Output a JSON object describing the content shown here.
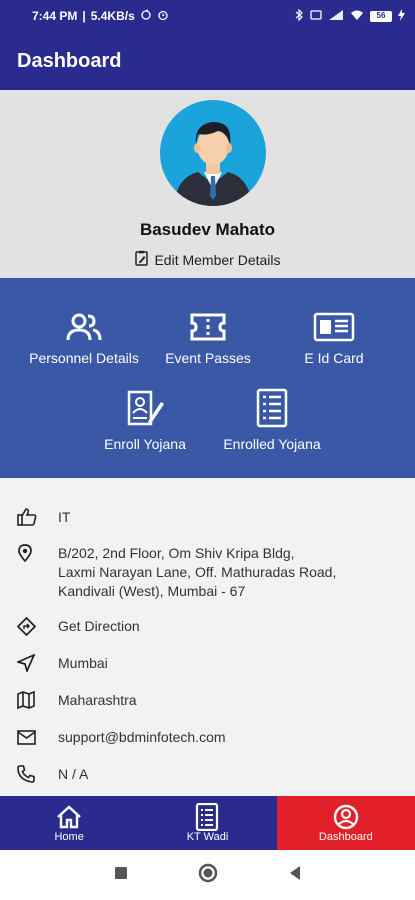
{
  "status_bar": {
    "time": "7:44 PM",
    "speed": "5.4KB/s",
    "battery": "56"
  },
  "app_bar": {
    "title": "Dashboard"
  },
  "profile": {
    "name": "Basudev Mahato",
    "edit_label": "Edit Member Details"
  },
  "actions": [
    {
      "label": "Personnel Details",
      "icon": "people-icon"
    },
    {
      "label": "Event Passes",
      "icon": "ticket-icon"
    },
    {
      "label": "E Id Card",
      "icon": "id-card-icon"
    },
    {
      "label": "Enroll Yojana",
      "icon": "enroll-form-icon"
    },
    {
      "label": "Enrolled Yojana",
      "icon": "checklist-icon"
    }
  ],
  "info": {
    "category": "IT",
    "address": [
      "B/202, 2nd Floor, Om Shiv Kripa Bldg,",
      "Laxmi Narayan Lane, Off. Mathuradas Road,",
      "Kandivali (West), Mumbai - 67"
    ],
    "direction": "Get Direction",
    "city": "Mumbai",
    "state": "Maharashtra",
    "email": "support@bdminfotech.com",
    "phone": "N / A"
  },
  "bottom_nav": [
    {
      "label": "Home",
      "icon": "home-icon"
    },
    {
      "label": "KT Wadi",
      "icon": "list-book-icon"
    },
    {
      "label": "Dashboard",
      "icon": "account-circle-icon"
    }
  ],
  "colors": {
    "primary": "#2a2b8f",
    "panel": "#3a58a6",
    "active_tab": "#e2202a"
  }
}
